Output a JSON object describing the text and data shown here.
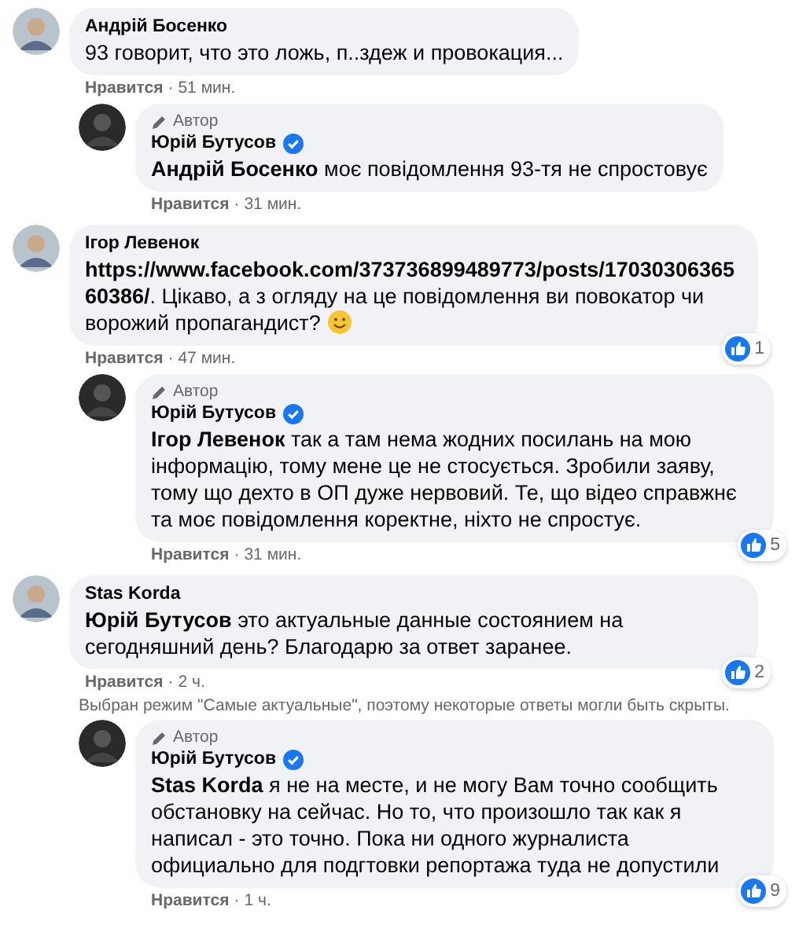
{
  "comments": [
    {
      "kind": "comment",
      "author": "Андрій Босенко",
      "verified": false,
      "text": "93 говорит, что это ложь, п..здеж и провокация...",
      "smiley": false,
      "like": "Нравится",
      "separator": "·",
      "time": "51 мин."
    },
    {
      "kind": "reply",
      "author": "Юрій Бутусов",
      "author_badge": "Автор",
      "verified": true,
      "text": "**Андрій Босенко** моє повідомлення 93-тя не спростовує",
      "smiley": false,
      "like": "Нравится",
      "separator": "·",
      "time": "31 мин."
    },
    {
      "kind": "comment",
      "author": "Ігор Левенок",
      "verified": false,
      "text": "**https://www.facebook.com/373736899489773/posts/1703030636560386/**. Цікаво, а з огляду на це повідомлення ви повокатор чи ворожий пропагандист?",
      "smiley": true,
      "like": "Нравится",
      "separator": "·",
      "time": "47 мин.",
      "reactions": "1"
    },
    {
      "kind": "reply",
      "author": "Юрій Бутусов",
      "author_badge": "Автор",
      "verified": true,
      "text": "**Ігор Левенок** так а там нема жодних посилань на мою інформацію, тому мене це не стосується. Зробили заяву, тому що дехто в ОП дуже нервовий. Те, що відео справжнє та моє повідомлення коректне, ніхто не спростує.",
      "smiley": false,
      "like": "Нравится",
      "separator": "·",
      "time": "31 мин.",
      "reactions": "5"
    },
    {
      "kind": "comment",
      "author": "Stas Korda",
      "verified": false,
      "text": "**Юрій Бутусов** это актуальные данные состоянием на сегодняшний день? Благодарю за ответ заранее.",
      "smiley": false,
      "like": "Нравится",
      "separator": "·",
      "time": "2 ч.",
      "reactions": "2"
    },
    {
      "kind": "notice",
      "text": "Выбран режим \"Самые актуальные\", поэтому некоторые ответы могли быть скрыты."
    },
    {
      "kind": "reply",
      "author": "Юрій Бутусов",
      "author_badge": "Автор",
      "verified": true,
      "text": "**Stas Korda** я не на месте, и не могу Вам точно сообщить обстановку на сейчас. Но то, что произошло так как я написал - это точно. Пока ни одного журналиста официально для подгтовки репортажа туда не допустили",
      "smiley": false,
      "like": "Нравится",
      "separator": "·",
      "time": "1 ч.",
      "reactions": "9"
    }
  ]
}
